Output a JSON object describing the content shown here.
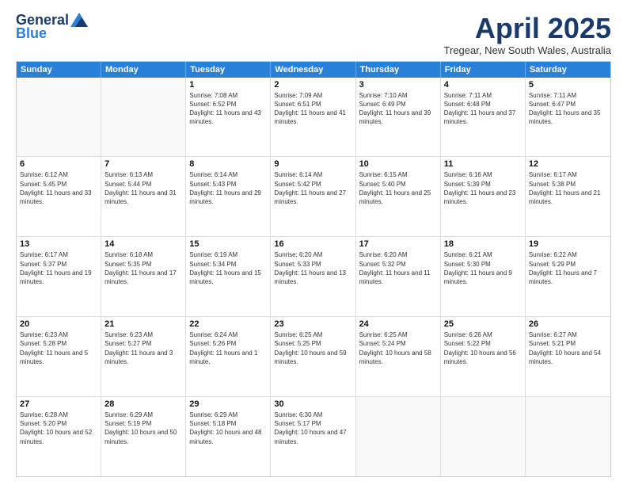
{
  "header": {
    "logo_general": "General",
    "logo_blue": "Blue",
    "month_title": "April 2025",
    "subtitle": "Tregear, New South Wales, Australia"
  },
  "weekdays": [
    "Sunday",
    "Monday",
    "Tuesday",
    "Wednesday",
    "Thursday",
    "Friday",
    "Saturday"
  ],
  "rows": [
    [
      {
        "day": "",
        "detail": ""
      },
      {
        "day": "",
        "detail": ""
      },
      {
        "day": "1",
        "detail": "Sunrise: 7:08 AM\nSunset: 6:52 PM\nDaylight: 11 hours and 43 minutes."
      },
      {
        "day": "2",
        "detail": "Sunrise: 7:09 AM\nSunset: 6:51 PM\nDaylight: 11 hours and 41 minutes."
      },
      {
        "day": "3",
        "detail": "Sunrise: 7:10 AM\nSunset: 6:49 PM\nDaylight: 11 hours and 39 minutes."
      },
      {
        "day": "4",
        "detail": "Sunrise: 7:11 AM\nSunset: 6:48 PM\nDaylight: 11 hours and 37 minutes."
      },
      {
        "day": "5",
        "detail": "Sunrise: 7:11 AM\nSunset: 6:47 PM\nDaylight: 11 hours and 35 minutes."
      }
    ],
    [
      {
        "day": "6",
        "detail": "Sunrise: 6:12 AM\nSunset: 5:45 PM\nDaylight: 11 hours and 33 minutes."
      },
      {
        "day": "7",
        "detail": "Sunrise: 6:13 AM\nSunset: 5:44 PM\nDaylight: 11 hours and 31 minutes."
      },
      {
        "day": "8",
        "detail": "Sunrise: 6:14 AM\nSunset: 5:43 PM\nDaylight: 11 hours and 29 minutes."
      },
      {
        "day": "9",
        "detail": "Sunrise: 6:14 AM\nSunset: 5:42 PM\nDaylight: 11 hours and 27 minutes."
      },
      {
        "day": "10",
        "detail": "Sunrise: 6:15 AM\nSunset: 5:40 PM\nDaylight: 11 hours and 25 minutes."
      },
      {
        "day": "11",
        "detail": "Sunrise: 6:16 AM\nSunset: 5:39 PM\nDaylight: 11 hours and 23 minutes."
      },
      {
        "day": "12",
        "detail": "Sunrise: 6:17 AM\nSunset: 5:38 PM\nDaylight: 11 hours and 21 minutes."
      }
    ],
    [
      {
        "day": "13",
        "detail": "Sunrise: 6:17 AM\nSunset: 5:37 PM\nDaylight: 11 hours and 19 minutes."
      },
      {
        "day": "14",
        "detail": "Sunrise: 6:18 AM\nSunset: 5:35 PM\nDaylight: 11 hours and 17 minutes."
      },
      {
        "day": "15",
        "detail": "Sunrise: 6:19 AM\nSunset: 5:34 PM\nDaylight: 11 hours and 15 minutes."
      },
      {
        "day": "16",
        "detail": "Sunrise: 6:20 AM\nSunset: 5:33 PM\nDaylight: 11 hours and 13 minutes."
      },
      {
        "day": "17",
        "detail": "Sunrise: 6:20 AM\nSunset: 5:32 PM\nDaylight: 11 hours and 11 minutes."
      },
      {
        "day": "18",
        "detail": "Sunrise: 6:21 AM\nSunset: 5:30 PM\nDaylight: 11 hours and 9 minutes."
      },
      {
        "day": "19",
        "detail": "Sunrise: 6:22 AM\nSunset: 5:29 PM\nDaylight: 11 hours and 7 minutes."
      }
    ],
    [
      {
        "day": "20",
        "detail": "Sunrise: 6:23 AM\nSunset: 5:28 PM\nDaylight: 11 hours and 5 minutes."
      },
      {
        "day": "21",
        "detail": "Sunrise: 6:23 AM\nSunset: 5:27 PM\nDaylight: 11 hours and 3 minutes."
      },
      {
        "day": "22",
        "detail": "Sunrise: 6:24 AM\nSunset: 5:26 PM\nDaylight: 11 hours and 1 minute."
      },
      {
        "day": "23",
        "detail": "Sunrise: 6:25 AM\nSunset: 5:25 PM\nDaylight: 10 hours and 59 minutes."
      },
      {
        "day": "24",
        "detail": "Sunrise: 6:25 AM\nSunset: 5:24 PM\nDaylight: 10 hours and 58 minutes."
      },
      {
        "day": "25",
        "detail": "Sunrise: 6:26 AM\nSunset: 5:22 PM\nDaylight: 10 hours and 56 minutes."
      },
      {
        "day": "26",
        "detail": "Sunrise: 6:27 AM\nSunset: 5:21 PM\nDaylight: 10 hours and 54 minutes."
      }
    ],
    [
      {
        "day": "27",
        "detail": "Sunrise: 6:28 AM\nSunset: 5:20 PM\nDaylight: 10 hours and 52 minutes."
      },
      {
        "day": "28",
        "detail": "Sunrise: 6:29 AM\nSunset: 5:19 PM\nDaylight: 10 hours and 50 minutes."
      },
      {
        "day": "29",
        "detail": "Sunrise: 6:29 AM\nSunset: 5:18 PM\nDaylight: 10 hours and 48 minutes."
      },
      {
        "day": "30",
        "detail": "Sunrise: 6:30 AM\nSunset: 5:17 PM\nDaylight: 10 hours and 47 minutes."
      },
      {
        "day": "",
        "detail": ""
      },
      {
        "day": "",
        "detail": ""
      },
      {
        "day": "",
        "detail": ""
      }
    ]
  ]
}
